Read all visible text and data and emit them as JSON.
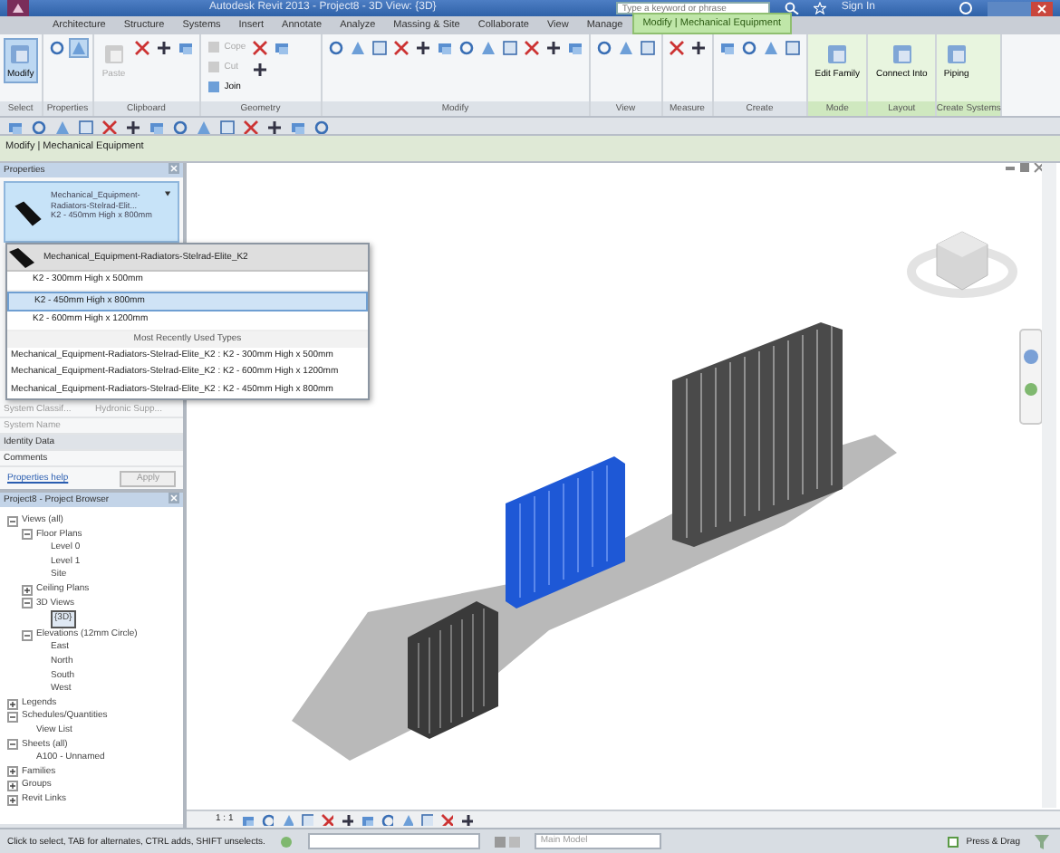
{
  "window": {
    "title": "Autodesk Revit 2013 -   Project8 - 3D View: {3D}",
    "search_placeholder": "Type a keyword or phrase",
    "sign_in": "Sign In"
  },
  "tabs": [
    {
      "label": "Architecture",
      "selected": false
    },
    {
      "label": "Structure",
      "selected": false
    },
    {
      "label": "Systems",
      "selected": false
    },
    {
      "label": "Insert",
      "selected": false
    },
    {
      "label": "Annotate",
      "selected": false
    },
    {
      "label": "Analyze",
      "selected": false
    },
    {
      "label": "Massing & Site",
      "selected": false
    },
    {
      "label": "Collaborate",
      "selected": false
    },
    {
      "label": "View",
      "selected": false
    },
    {
      "label": "Manage",
      "selected": false
    },
    {
      "label": "Modify | Mechanical Equipment",
      "selected": true
    }
  ],
  "ribbon": [
    {
      "label": "Select",
      "tools": [
        {
          "kind": "large",
          "label": "Modify",
          "selected": true,
          "disabled": false
        }
      ]
    },
    {
      "label": "Properties",
      "tools": [
        {
          "kind": "small",
          "selected": false,
          "disabled": false
        },
        {
          "kind": "small",
          "selected": true,
          "disabled": false
        }
      ]
    },
    {
      "label": "Clipboard",
      "tools": [
        {
          "kind": "large",
          "label": "Paste",
          "selected": false,
          "disabled": true
        },
        {
          "kind": "small",
          "selected": false,
          "disabled": false
        },
        {
          "kind": "small",
          "selected": false,
          "disabled": false
        },
        {
          "kind": "small",
          "selected": false,
          "disabled": false
        }
      ]
    },
    {
      "label": "Geometry",
      "tools": [
        {
          "kind": "row",
          "label": "Cope",
          "selected": false,
          "disabled": true
        },
        {
          "kind": "row",
          "label": "Cut",
          "selected": false,
          "disabled": true
        },
        {
          "kind": "row",
          "label": "Join",
          "selected": false,
          "disabled": false
        },
        {
          "kind": "small",
          "selected": false,
          "disabled": false
        },
        {
          "kind": "small",
          "selected": false,
          "disabled": false
        },
        {
          "kind": "small",
          "selected": false,
          "disabled": false
        }
      ]
    },
    {
      "label": "Modify",
      "tools": [
        {
          "kind": "small",
          "selected": false,
          "disabled": false
        },
        {
          "kind": "small",
          "selected": false,
          "disabled": false
        },
        {
          "kind": "small",
          "selected": false,
          "disabled": false
        },
        {
          "kind": "small",
          "selected": false,
          "disabled": false
        },
        {
          "kind": "small",
          "selected": false,
          "disabled": false
        },
        {
          "kind": "small",
          "selected": false,
          "disabled": false
        },
        {
          "kind": "small",
          "selected": false,
          "disabled": false
        },
        {
          "kind": "small",
          "selected": false,
          "disabled": false
        },
        {
          "kind": "small",
          "selected": false,
          "disabled": false
        },
        {
          "kind": "small",
          "selected": false,
          "disabled": false
        },
        {
          "kind": "small",
          "selected": false,
          "disabled": false
        },
        {
          "kind": "small",
          "selected": false,
          "disabled": false
        }
      ]
    },
    {
      "label": "View",
      "tools": [
        {
          "kind": "small",
          "selected": false,
          "disabled": false
        },
        {
          "kind": "small",
          "selected": false,
          "disabled": false
        },
        {
          "kind": "small",
          "selected": false,
          "disabled": false
        }
      ]
    },
    {
      "label": "Measure",
      "tools": [
        {
          "kind": "small",
          "selected": false,
          "disabled": false
        },
        {
          "kind": "small",
          "selected": false,
          "disabled": false
        }
      ]
    },
    {
      "label": "Create",
      "tools": [
        {
          "kind": "small",
          "selected": false,
          "disabled": false
        },
        {
          "kind": "small",
          "selected": false,
          "disabled": false
        },
        {
          "kind": "small",
          "selected": false,
          "disabled": false
        },
        {
          "kind": "small",
          "selected": false,
          "disabled": false
        }
      ]
    },
    {
      "label": "Mode",
      "tools": [
        {
          "kind": "large",
          "label": "Edit Family",
          "selected": false,
          "disabled": false
        }
      ]
    },
    {
      "label": "Layout",
      "tools": [
        {
          "kind": "large",
          "label": "Connect Into",
          "selected": false,
          "disabled": false
        }
      ]
    },
    {
      "label": "Create Systems",
      "tools": [
        {
          "kind": "large",
          "label": "Piping",
          "selected": false,
          "disabled": false
        }
      ]
    }
  ],
  "options_bar": "Modify | Mechanical Equipment",
  "properties": {
    "title": "Properties",
    "type_family": "Mechanical_Equipment-Radiators-Stelrad-Elit...",
    "type_name": "K2 - 450mm High x 800mm",
    "rows": [
      {
        "name": "System Classif...",
        "value": "Hydronic Supp..."
      },
      {
        "name": "System Name"
      }
    ],
    "group": "Identity Data",
    "comments_label": "Comments",
    "help_link": "Properties help",
    "apply": "Apply"
  },
  "type_dropdown": {
    "family": "Mechanical_Equipment-Radiators-Stelrad-Elite_K2",
    "types": [
      {
        "label": "K2 - 300mm High x 500mm",
        "selected": false
      },
      {
        "label": "K2 - 450mm High x 800mm",
        "selected": true
      },
      {
        "label": "K2 - 600mm High x 1200mm",
        "selected": false
      }
    ],
    "recent_heading": "Most Recently Used Types",
    "recent": [
      "Mechanical_Equipment-Radiators-Stelrad-Elite_K2 : K2 - 300mm High x 500mm",
      "Mechanical_Equipment-Radiators-Stelrad-Elite_K2 : K2 - 600mm High x 1200mm",
      "Mechanical_Equipment-Radiators-Stelrad-Elite_K2 : K2 - 450mm High x 800mm"
    ]
  },
  "project_browser": {
    "title": "Project8 - Project Browser",
    "tree": [
      {
        "label": "Views (all)",
        "expanded": true,
        "selected": false,
        "children": [
          {
            "label": "Floor Plans",
            "expanded": true,
            "selected": false,
            "children": [
              {
                "label": "Level 0",
                "selected": false
              },
              {
                "label": "Level 1",
                "selected": false
              },
              {
                "label": "Site",
                "selected": false
              }
            ]
          },
          {
            "label": "Ceiling Plans",
            "expanded": false,
            "selected": false
          },
          {
            "label": "3D Views",
            "expanded": true,
            "selected": false,
            "children": [
              {
                "label": "{3D}",
                "selected": true
              }
            ]
          },
          {
            "label": "Elevations (12mm Circle)",
            "expanded": true,
            "selected": false,
            "children": [
              {
                "label": "East",
                "selected": false
              },
              {
                "label": "North",
                "selected": false
              },
              {
                "label": "South",
                "selected": false
              },
              {
                "label": "West",
                "selected": false
              }
            ]
          }
        ]
      },
      {
        "label": "Legends",
        "expanded": false,
        "selected": false
      },
      {
        "label": "Schedules/Quantities",
        "expanded": true,
        "selected": false,
        "children": [
          {
            "label": "View List",
            "selected": false
          }
        ]
      },
      {
        "label": "Sheets (all)",
        "expanded": true,
        "selected": false,
        "children": [
          {
            "label": "A100 - Unnamed",
            "selected": false
          }
        ]
      },
      {
        "label": "Families",
        "expanded": false,
        "selected": false
      },
      {
        "label": "Groups",
        "expanded": false,
        "selected": false
      },
      {
        "label": "Revit Links",
        "expanded": false,
        "selected": false
      }
    ]
  },
  "view_bar": {
    "scale": "1 : 1"
  },
  "status_bar": {
    "hint": "Click to select, TAB for alternates, CTRL adds, SHIFT unselects.",
    "workset": "Main Model",
    "press_drag": "Press & Drag"
  }
}
